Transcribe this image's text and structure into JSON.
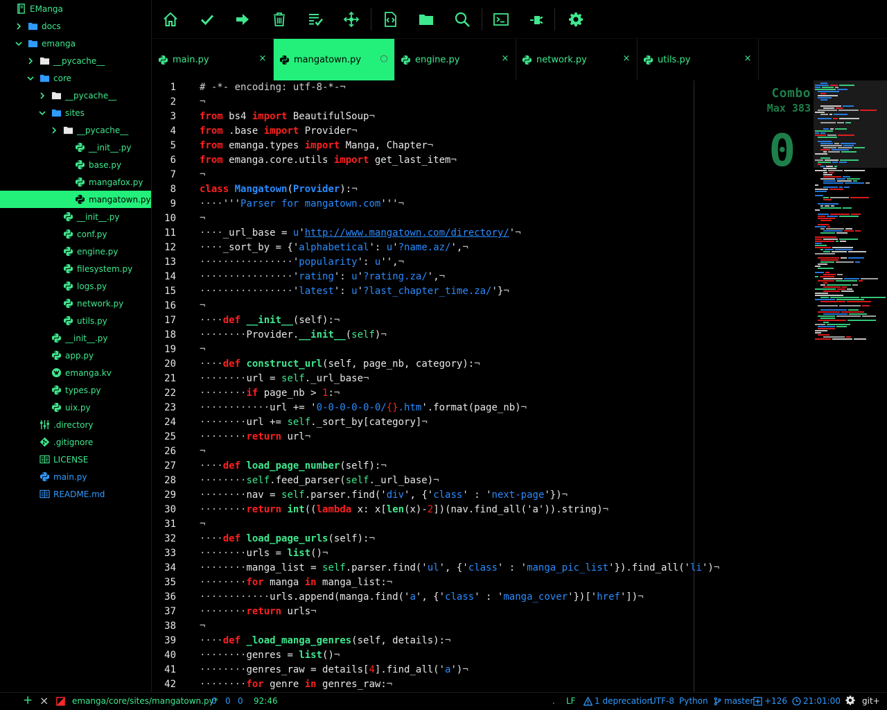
{
  "sidebar": {
    "items": [
      {
        "label": "EManga",
        "depth": 0,
        "chevron": "none",
        "icon": "book-icon",
        "color": "green"
      },
      {
        "label": "docs",
        "depth": 1,
        "chevron": "right",
        "icon": "folder-icon",
        "color": "green"
      },
      {
        "label": "emanga",
        "depth": 1,
        "chevron": "down",
        "icon": "folder-icon",
        "color": "green"
      },
      {
        "label": "__pycache__",
        "depth": 2,
        "chevron": "right",
        "icon": "folder-icon",
        "color": "white"
      },
      {
        "label": "core",
        "depth": 2,
        "chevron": "down",
        "icon": "folder-icon",
        "color": "green"
      },
      {
        "label": "__pycache__",
        "depth": 3,
        "chevron": "right",
        "icon": "folder-icon",
        "color": "white"
      },
      {
        "label": "sites",
        "depth": 3,
        "chevron": "down",
        "icon": "folder-icon",
        "color": "green"
      },
      {
        "label": "__pycache__",
        "depth": 4,
        "chevron": "right",
        "icon": "folder-icon",
        "color": "white"
      },
      {
        "label": "__init__.py",
        "depth": 5,
        "chevron": "none",
        "icon": "python-icon",
        "color": "green"
      },
      {
        "label": "base.py",
        "depth": 5,
        "chevron": "none",
        "icon": "python-icon",
        "color": "green"
      },
      {
        "label": "mangafox.py",
        "depth": 5,
        "chevron": "none",
        "icon": "python-icon",
        "color": "green"
      },
      {
        "label": "mangatown.py",
        "depth": 5,
        "chevron": "none",
        "icon": "python-icon",
        "color": "green",
        "selected": true
      },
      {
        "label": "__init__.py",
        "depth": 4,
        "chevron": "none",
        "icon": "python-icon",
        "color": "green"
      },
      {
        "label": "conf.py",
        "depth": 4,
        "chevron": "none",
        "icon": "python-icon",
        "color": "green"
      },
      {
        "label": "engine.py",
        "depth": 4,
        "chevron": "none",
        "icon": "python-icon",
        "color": "green"
      },
      {
        "label": "filesystem.py",
        "depth": 4,
        "chevron": "none",
        "icon": "python-icon",
        "color": "green"
      },
      {
        "label": "logs.py",
        "depth": 4,
        "chevron": "none",
        "icon": "python-icon",
        "color": "green"
      },
      {
        "label": "network.py",
        "depth": 4,
        "chevron": "none",
        "icon": "python-icon",
        "color": "green"
      },
      {
        "label": "utils.py",
        "depth": 4,
        "chevron": "none",
        "icon": "python-icon",
        "color": "green"
      },
      {
        "label": "__init__.py",
        "depth": 3,
        "chevron": "none",
        "icon": "python-icon",
        "color": "green"
      },
      {
        "label": "app.py",
        "depth": 3,
        "chevron": "none",
        "icon": "python-icon",
        "color": "green"
      },
      {
        "label": "emanga.kv",
        "depth": 3,
        "chevron": "none",
        "icon": "kivy-icon",
        "color": "green"
      },
      {
        "label": "types.py",
        "depth": 3,
        "chevron": "none",
        "icon": "python-icon",
        "color": "green"
      },
      {
        "label": "uix.py",
        "depth": 3,
        "chevron": "none",
        "icon": "python-icon",
        "color": "green"
      },
      {
        "label": ".directory",
        "depth": 2,
        "chevron": "none",
        "icon": "settings-file-icon",
        "color": "green"
      },
      {
        "label": ".gitignore",
        "depth": 2,
        "chevron": "none",
        "icon": "git-icon",
        "color": "green"
      },
      {
        "label": "LICENSE",
        "depth": 2,
        "chevron": "none",
        "icon": "book-file-icon",
        "color": "green"
      },
      {
        "label": "main.py",
        "depth": 2,
        "chevron": "none",
        "icon": "python-icon",
        "color": "blue"
      },
      {
        "label": "README.md",
        "depth": 2,
        "chevron": "none",
        "icon": "book-file-icon",
        "color": "blue"
      }
    ]
  },
  "toolbar": {
    "buttons": [
      "home-icon",
      "check-icon",
      "arrow-right-icon",
      "trash-icon",
      "checklist-icon",
      "move-icon",
      "code-file-icon",
      "folder-icon",
      "search-icon",
      "terminal-icon",
      "plug-icon",
      "gear-icon"
    ]
  },
  "tabs": [
    {
      "label": "main.py",
      "active": false,
      "close": "×"
    },
    {
      "label": "mangatown.py",
      "active": true,
      "close": "○"
    },
    {
      "label": "engine.py",
      "active": false,
      "close": "×"
    },
    {
      "label": "network.py",
      "active": false,
      "close": "×"
    },
    {
      "label": "utils.py",
      "active": false,
      "close": "×"
    }
  ],
  "editor": {
    "start_line": 1,
    "lines": [
      [
        [
          "com",
          "# -*- encoding: utf-8-*-"
        ],
        [
          "ws",
          "¬"
        ]
      ],
      [
        [
          "ws",
          "¬"
        ]
      ],
      [
        [
          "kw",
          "from"
        ],
        [
          "pl",
          " bs4 "
        ],
        [
          "kw",
          "import"
        ],
        [
          "pl",
          " BeautifulSoup"
        ],
        [
          "ws",
          "¬"
        ]
      ],
      [
        [
          "kw",
          "from"
        ],
        [
          "pl",
          " .base "
        ],
        [
          "kw",
          "import"
        ],
        [
          "pl",
          " Provider"
        ],
        [
          "ws",
          "¬"
        ]
      ],
      [
        [
          "kw",
          "from"
        ],
        [
          "pl",
          " emanga.types "
        ],
        [
          "kw",
          "import"
        ],
        [
          "pl",
          " Manga, Chapter"
        ],
        [
          "ws",
          "¬"
        ]
      ],
      [
        [
          "kw",
          "from"
        ],
        [
          "pl",
          " emanga.core.utils "
        ],
        [
          "kw",
          "import"
        ],
        [
          "pl",
          " get_last_item"
        ],
        [
          "ws",
          "¬"
        ]
      ],
      [
        [
          "ws",
          "¬"
        ]
      ],
      [
        [
          "kw",
          "class"
        ],
        [
          "pl",
          " "
        ],
        [
          "cls",
          "Mangatown"
        ],
        [
          "pl",
          "("
        ],
        [
          "cls",
          "Provider"
        ],
        [
          "pl",
          "):"
        ],
        [
          "ws",
          "¬"
        ]
      ],
      [
        [
          "ws",
          "····"
        ],
        [
          "pl",
          "'''"
        ],
        [
          "str",
          "Parser for mangatown.com"
        ],
        [
          "pl",
          "'''"
        ],
        [
          "ws",
          "¬"
        ]
      ],
      [
        [
          "ws",
          "¬"
        ]
      ],
      [
        [
          "ws",
          "····"
        ],
        [
          "pl",
          "_url_base = "
        ],
        [
          "str",
          "u"
        ],
        [
          "pl",
          "'"
        ],
        [
          "url",
          "http://www.mangatown.com/directory/"
        ],
        [
          "pl",
          "'"
        ],
        [
          "ws",
          "¬"
        ]
      ],
      [
        [
          "ws",
          "····"
        ],
        [
          "pl",
          "_sort_by = {'"
        ],
        [
          "str",
          "alphabetical"
        ],
        [
          "pl",
          "': "
        ],
        [
          "str",
          "u"
        ],
        [
          "pl",
          "'"
        ],
        [
          "str",
          "?name.az/"
        ],
        [
          "pl",
          "',"
        ],
        [
          "ws",
          "¬"
        ]
      ],
      [
        [
          "ws",
          "················"
        ],
        [
          "pl",
          "'"
        ],
        [
          "str",
          "popularity"
        ],
        [
          "pl",
          "': "
        ],
        [
          "str",
          "u"
        ],
        [
          "pl",
          "'',"
        ],
        [
          "ws",
          "¬"
        ]
      ],
      [
        [
          "ws",
          "················"
        ],
        [
          "pl",
          "'"
        ],
        [
          "str",
          "rating"
        ],
        [
          "pl",
          "': "
        ],
        [
          "str",
          "u"
        ],
        [
          "pl",
          "'"
        ],
        [
          "str",
          "?rating.za/"
        ],
        [
          "pl",
          "',"
        ],
        [
          "ws",
          "¬"
        ]
      ],
      [
        [
          "ws",
          "················"
        ],
        [
          "pl",
          "'"
        ],
        [
          "str",
          "latest"
        ],
        [
          "pl",
          "': "
        ],
        [
          "str",
          "u"
        ],
        [
          "pl",
          "'"
        ],
        [
          "str",
          "?last_chapter_time.za/"
        ],
        [
          "pl",
          "'}"
        ],
        [
          "ws",
          "¬"
        ]
      ],
      [
        [
          "ws",
          "¬"
        ]
      ],
      [
        [
          "ws",
          "····"
        ],
        [
          "kw",
          "def"
        ],
        [
          "pl",
          " "
        ],
        [
          "fn",
          "__init__"
        ],
        [
          "pl",
          "(self):"
        ],
        [
          "ws",
          "¬"
        ]
      ],
      [
        [
          "ws",
          "········"
        ],
        [
          "pl",
          "Provider."
        ],
        [
          "fn",
          "__init__"
        ],
        [
          "pl",
          "("
        ],
        [
          "self",
          "self"
        ],
        [
          "pl",
          ")"
        ],
        [
          "ws",
          "¬"
        ]
      ],
      [
        [
          "ws",
          "¬"
        ]
      ],
      [
        [
          "ws",
          "····"
        ],
        [
          "kw",
          "def"
        ],
        [
          "pl",
          " "
        ],
        [
          "fn",
          "construct_url"
        ],
        [
          "pl",
          "(self, page_nb, category):"
        ],
        [
          "ws",
          "¬"
        ]
      ],
      [
        [
          "ws",
          "········"
        ],
        [
          "pl",
          "url = "
        ],
        [
          "self",
          "self"
        ],
        [
          "pl",
          "._url_base"
        ],
        [
          "ws",
          "¬"
        ]
      ],
      [
        [
          "ws",
          "········"
        ],
        [
          "kw",
          "if"
        ],
        [
          "pl",
          " page_nb > "
        ],
        [
          "num",
          "1"
        ],
        [
          "pl",
          ":"
        ],
        [
          "ws",
          "¬"
        ]
      ],
      [
        [
          "ws",
          "············"
        ],
        [
          "pl",
          "url += '"
        ],
        [
          "str",
          "0-0-0-0-0-0/"
        ],
        [
          "num",
          "{}"
        ],
        [
          "str",
          ".htm"
        ],
        [
          "pl",
          "'.format(page_nb)"
        ],
        [
          "ws",
          "¬"
        ]
      ],
      [
        [
          "ws",
          "········"
        ],
        [
          "pl",
          "url += "
        ],
        [
          "self",
          "self"
        ],
        [
          "pl",
          "._sort_by[category]"
        ],
        [
          "ws",
          "¬"
        ]
      ],
      [
        [
          "ws",
          "········"
        ],
        [
          "kw",
          "return"
        ],
        [
          "pl",
          " url"
        ],
        [
          "ws",
          "¬"
        ]
      ],
      [
        [
          "ws",
          "¬"
        ]
      ],
      [
        [
          "ws",
          "····"
        ],
        [
          "kw",
          "def"
        ],
        [
          "pl",
          " "
        ],
        [
          "fn",
          "load_page_number"
        ],
        [
          "pl",
          "(self):"
        ],
        [
          "ws",
          "¬"
        ]
      ],
      [
        [
          "ws",
          "········"
        ],
        [
          "self",
          "self"
        ],
        [
          "pl",
          ".feed_parser("
        ],
        [
          "self",
          "self"
        ],
        [
          "pl",
          "._url_base)"
        ],
        [
          "ws",
          "¬"
        ]
      ],
      [
        [
          "ws",
          "········"
        ],
        [
          "pl",
          "nav = "
        ],
        [
          "self",
          "self"
        ],
        [
          "pl",
          ".parser.find('"
        ],
        [
          "str",
          "div"
        ],
        [
          "pl",
          "', {'"
        ],
        [
          "str",
          "class"
        ],
        [
          "pl",
          "' : '"
        ],
        [
          "str",
          "next-page"
        ],
        [
          "pl",
          "'})"
        ],
        [
          "ws",
          "¬"
        ]
      ],
      [
        [
          "ws",
          "········"
        ],
        [
          "kw",
          "return"
        ],
        [
          "pl",
          " "
        ],
        [
          "fn",
          "int"
        ],
        [
          "pl",
          "(("
        ],
        [
          "kw",
          "lambda"
        ],
        [
          "pl",
          " x: x["
        ],
        [
          "fn",
          "len"
        ],
        [
          "pl",
          "(x)-"
        ],
        [
          "num",
          "2"
        ],
        [
          "pl",
          "])(nav.find_all('a')).string)"
        ],
        [
          "ws",
          "¬"
        ]
      ],
      [
        [
          "ws",
          "¬"
        ]
      ],
      [
        [
          "ws",
          "····"
        ],
        [
          "kw",
          "def"
        ],
        [
          "pl",
          " "
        ],
        [
          "fn",
          "load_page_urls"
        ],
        [
          "pl",
          "(self):"
        ],
        [
          "ws",
          "¬"
        ]
      ],
      [
        [
          "ws",
          "········"
        ],
        [
          "pl",
          "urls = "
        ],
        [
          "fn",
          "list"
        ],
        [
          "pl",
          "()"
        ],
        [
          "ws",
          "¬"
        ]
      ],
      [
        [
          "ws",
          "········"
        ],
        [
          "pl",
          "manga_list = "
        ],
        [
          "self",
          "self"
        ],
        [
          "pl",
          ".parser.find('"
        ],
        [
          "str",
          "ul"
        ],
        [
          "pl",
          "', {'"
        ],
        [
          "str",
          "class"
        ],
        [
          "pl",
          "' : '"
        ],
        [
          "str",
          "manga_pic_list"
        ],
        [
          "pl",
          "'}).find_all('"
        ],
        [
          "str",
          "li"
        ],
        [
          "pl",
          "')"
        ],
        [
          "ws",
          "¬"
        ]
      ],
      [
        [
          "ws",
          "········"
        ],
        [
          "kw",
          "for"
        ],
        [
          "pl",
          " manga "
        ],
        [
          "kw",
          "in"
        ],
        [
          "pl",
          " manga_list:"
        ],
        [
          "ws",
          "¬"
        ]
      ],
      [
        [
          "ws",
          "············"
        ],
        [
          "pl",
          "urls.append(manga.find('"
        ],
        [
          "str",
          "a"
        ],
        [
          "pl",
          "', {'"
        ],
        [
          "str",
          "class"
        ],
        [
          "pl",
          "' : '"
        ],
        [
          "str",
          "manga_cover"
        ],
        [
          "pl",
          "'})['"
        ],
        [
          "str",
          "href"
        ],
        [
          "pl",
          "'])"
        ],
        [
          "ws",
          "¬"
        ]
      ],
      [
        [
          "ws",
          "········"
        ],
        [
          "kw",
          "return"
        ],
        [
          "pl",
          " urls"
        ],
        [
          "ws",
          "¬"
        ]
      ],
      [
        [
          "ws",
          "¬"
        ]
      ],
      [
        [
          "ws",
          "····"
        ],
        [
          "kw",
          "def"
        ],
        [
          "pl",
          " "
        ],
        [
          "fn",
          "_load_manga_genres"
        ],
        [
          "pl",
          "(self, details):"
        ],
        [
          "ws",
          "¬"
        ]
      ],
      [
        [
          "ws",
          "········"
        ],
        [
          "pl",
          "genres = "
        ],
        [
          "fn",
          "list"
        ],
        [
          "pl",
          "()"
        ],
        [
          "ws",
          "¬"
        ]
      ],
      [
        [
          "ws",
          "········"
        ],
        [
          "pl",
          "genres_raw = details["
        ],
        [
          "num",
          "4"
        ],
        [
          "pl",
          "].find_all('"
        ],
        [
          "str",
          "a"
        ],
        [
          "pl",
          "')"
        ],
        [
          "ws",
          "¬"
        ]
      ],
      [
        [
          "ws",
          "········"
        ],
        [
          "kw",
          "for"
        ],
        [
          "pl",
          " genre "
        ],
        [
          "kw",
          "in"
        ],
        [
          "pl",
          " genres_raw:"
        ],
        [
          "ws",
          "¬"
        ]
      ]
    ]
  },
  "combo": {
    "title": "Combo",
    "max": "Max 383",
    "count": "0"
  },
  "statusbar": {
    "add": "+",
    "close": "×",
    "path": "emanga/core/sites/mangatown.py*",
    "counts": [
      "0",
      "0",
      "0"
    ],
    "cursor": "92:46",
    "dot": ".",
    "line_ending": "LF",
    "deprecation": "1 deprecation",
    "encoding": "UTF-8",
    "grammar": "Python",
    "branch": "master",
    "diff": "+126",
    "time": "21:01:00",
    "git": "git+"
  },
  "colors": {
    "accent": "#23f07b",
    "text_green": "#3fe88e",
    "keyword_red": "#ff1f1f",
    "string_blue": "#2a8cff",
    "background": "#000000"
  }
}
